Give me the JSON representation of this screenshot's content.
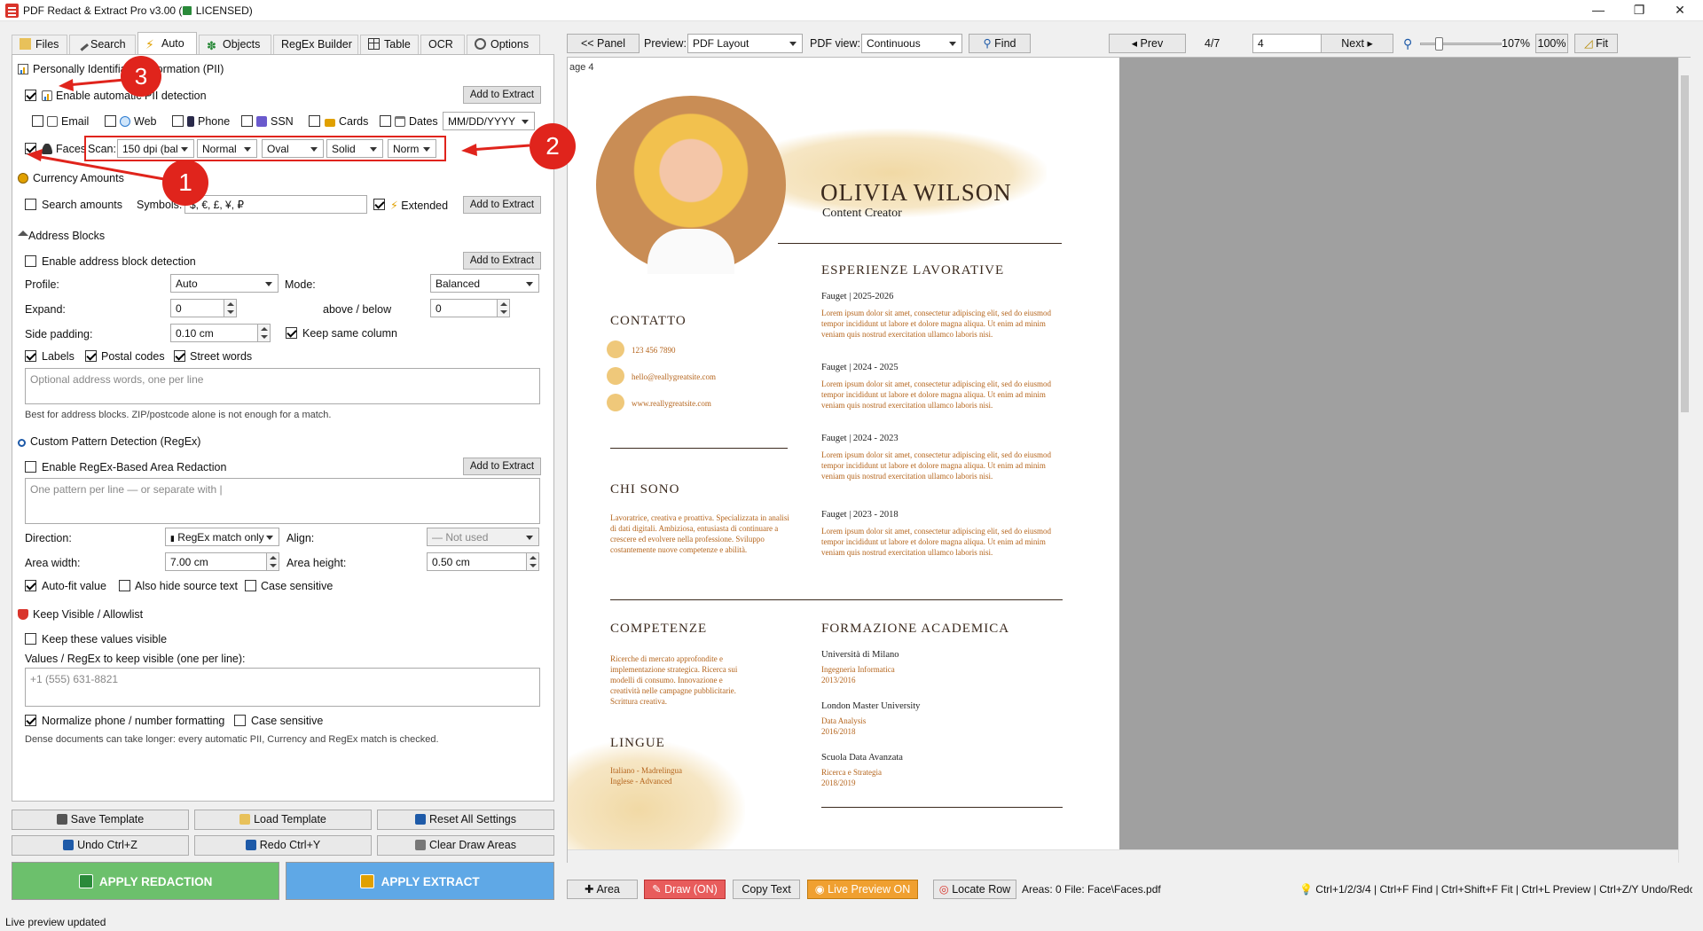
{
  "window": {
    "title_prefix": "PDF Redact & Extract Pro v3.00 (",
    "title_suffix": " LICENSED)",
    "minimize": "—",
    "maximize": "❐",
    "close": "✕"
  },
  "tabs": [
    "Files",
    "Search",
    "Auto",
    "Objects",
    "RegEx Builder",
    "Table",
    "OCR",
    "Options"
  ],
  "pii": {
    "title": "Personally Identifiable Information (PII)",
    "enable": "Enable automatic PII detection",
    "add": "Add to Extract",
    "email": "Email",
    "web": "Web",
    "phone": "Phone",
    "ssn": "SSN",
    "cards": "Cards",
    "dates": "Dates",
    "date_format": "MM/DD/YYYY",
    "faces": "Faces",
    "scan": "Scan:",
    "scan_dpi": "150 dpi (bal",
    "scan_mode": "Normal",
    "shape": "Oval",
    "fill": "Solid",
    "extra": "Norm"
  },
  "currency": {
    "title": "Currency Amounts",
    "search": "Search amounts",
    "symbols_label": "Symbols:",
    "symbols": "$, €, £, ¥, ₽",
    "extended": "Extended",
    "add": "Add to Extract"
  },
  "address": {
    "title": "Address Blocks",
    "enable": "Enable address block detection",
    "add": "Add to Extract",
    "profile_label": "Profile:",
    "profile": "Auto",
    "mode_label": "Mode:",
    "mode": "Balanced",
    "expand_label": "Expand:",
    "expand": "0",
    "above_label": "above / below",
    "above": "0",
    "padding_label": "Side padding:",
    "padding": "0.10 cm",
    "keep_col": "Keep same column",
    "labels": "Labels",
    "postal": "Postal codes",
    "street": "Street words",
    "placeholder": "Optional address words, one per line",
    "hint": "Best for address blocks. ZIP/postcode alone is not enough for a match."
  },
  "regex": {
    "title": "Custom Pattern Detection (RegEx)",
    "enable": "Enable RegEx-Based Area Redaction",
    "add": "Add to Extract",
    "placeholder": "One pattern per line  —  or separate with |",
    "direction_label": "Direction:",
    "direction": "RegEx match only",
    "align_label": "Align:",
    "align": "— Not used",
    "width_label": "Area width:",
    "width": "7.00 cm",
    "height_label": "Area height:",
    "height": "0.50 cm",
    "autofit": "Auto-fit value",
    "hide": "Also hide source text",
    "case": "Case sensitive"
  },
  "keep": {
    "title": "Keep Visible / Allowlist",
    "enable": "Keep these values visible",
    "values_label": "Values / RegEx to keep visible (one per line):",
    "placeholder": "+1 (555) 631-8821",
    "normalize": "Normalize phone / number formatting",
    "case": "Case sensitive",
    "hint": "Dense documents can take longer: every automatic PII, Currency and RegEx match is checked."
  },
  "buttons": {
    "save": "Save Template",
    "load": "Load Template",
    "reset": "Reset All Settings",
    "undo": "Undo  Ctrl+Z",
    "redo": "Redo  Ctrl+Y",
    "clear": "Clear Draw Areas",
    "apply_redact": "APPLY REDACTION",
    "apply_extract": "APPLY EXTRACT"
  },
  "status": "Live preview updated",
  "toolbar": {
    "panel": "<< Panel",
    "preview_label": "Preview:",
    "preview": "PDF Layout",
    "view_label": "PDF view:",
    "view": "Continuous",
    "find": "Find",
    "prev": "◂ Prev",
    "page_of": "4/7",
    "page": "4",
    "next": "Next ▸",
    "zoom": "107%",
    "zoom100": "100%",
    "fit": "Fit"
  },
  "bottombar": {
    "area": "Area",
    "draw": "Draw (ON)",
    "copy": "Copy Text",
    "live": "Live Preview ON",
    "locate": "Locate Row",
    "areas": "Areas: 0",
    "file": "File: Face\\Faces.pdf",
    "shortcuts": "Ctrl+1/2/3/4 | Ctrl+F Find | Ctrl+Shift+F Fit | Ctrl+L Preview | Ctrl+Z/Y Undo/Redc"
  },
  "cv": {
    "page_label": "age 4",
    "name": "OLIVIA WILSON",
    "role": "Content Creator",
    "exp_title": "ESPERIENZE LAVORATIVE",
    "jobs": [
      {
        "h": "Fauget | 2025-2026",
        "t": "Lorem ipsum dolor sit amet, consectetur adipiscing elit, sed do eiusmod tempor incididunt ut labore et dolore magna aliqua. Ut enim ad minim veniam quis nostrud exercitation ullamco laboris nisi."
      },
      {
        "h": "Fauget | 2024 - 2025",
        "t": "Lorem ipsum dolor sit amet, consectetur adipiscing elit, sed do eiusmod tempor incididunt ut labore et dolore magna aliqua. Ut enim ad minim veniam quis nostrud exercitation ullamco laboris nisi."
      },
      {
        "h": "Fauget | 2024 - 2023",
        "t": "Lorem ipsum dolor sit amet, consectetur adipiscing elit, sed do eiusmod tempor incididunt ut labore et dolore magna aliqua. Ut enim ad minim veniam quis nostrud exercitation ullamco laboris nisi."
      },
      {
        "h": "Fauget | 2023 - 2018",
        "t": "Lorem ipsum dolor sit amet, consectetur adipiscing elit, sed do eiusmod tempor incididunt ut labore et dolore magna aliqua. Ut enim ad minim veniam quis nostrud exercitation ullamco laboris nisi."
      }
    ],
    "contact_title": "CONTATTO",
    "phone": "123 456 7890",
    "email": "hello@reallygreatsite.com",
    "web": "www.reallygreatsite.com",
    "about_title": "CHI SONO",
    "about": "Lavoratrice, creativa e proattiva. Specializzata in analisi di dati digitali. Ambiziosa, entusiasta di continuare a crescere ed evolvere nella professione. Sviluppo costantemente nuove competenze e abilità.",
    "skills_title": "COMPETENZE",
    "skills": "Ricerche di mercato approfondite e implementazione strategica. Ricerca sui modelli di consumo. Innovazione e creatività nelle campagne pubblicitarie. Scrittura creativa.",
    "lang_title": "LINGUE",
    "langs": "Italiano - Madrelingua\nInglese - Advanced",
    "edu_title": "FORMAZIONE ACADEMICA",
    "edu": [
      {
        "s": "Università di Milano",
        "d": "Ingegneria Informatica",
        "y": "2013/2016"
      },
      {
        "s": "London Master University",
        "d": "Data Analysis",
        "y": "2016/2018"
      },
      {
        "s": "Scuola Data Avanzata",
        "d": "Ricerca e Strategia",
        "y": "2018/2019"
      }
    ]
  },
  "annotations": [
    "1",
    "2",
    "3"
  ]
}
